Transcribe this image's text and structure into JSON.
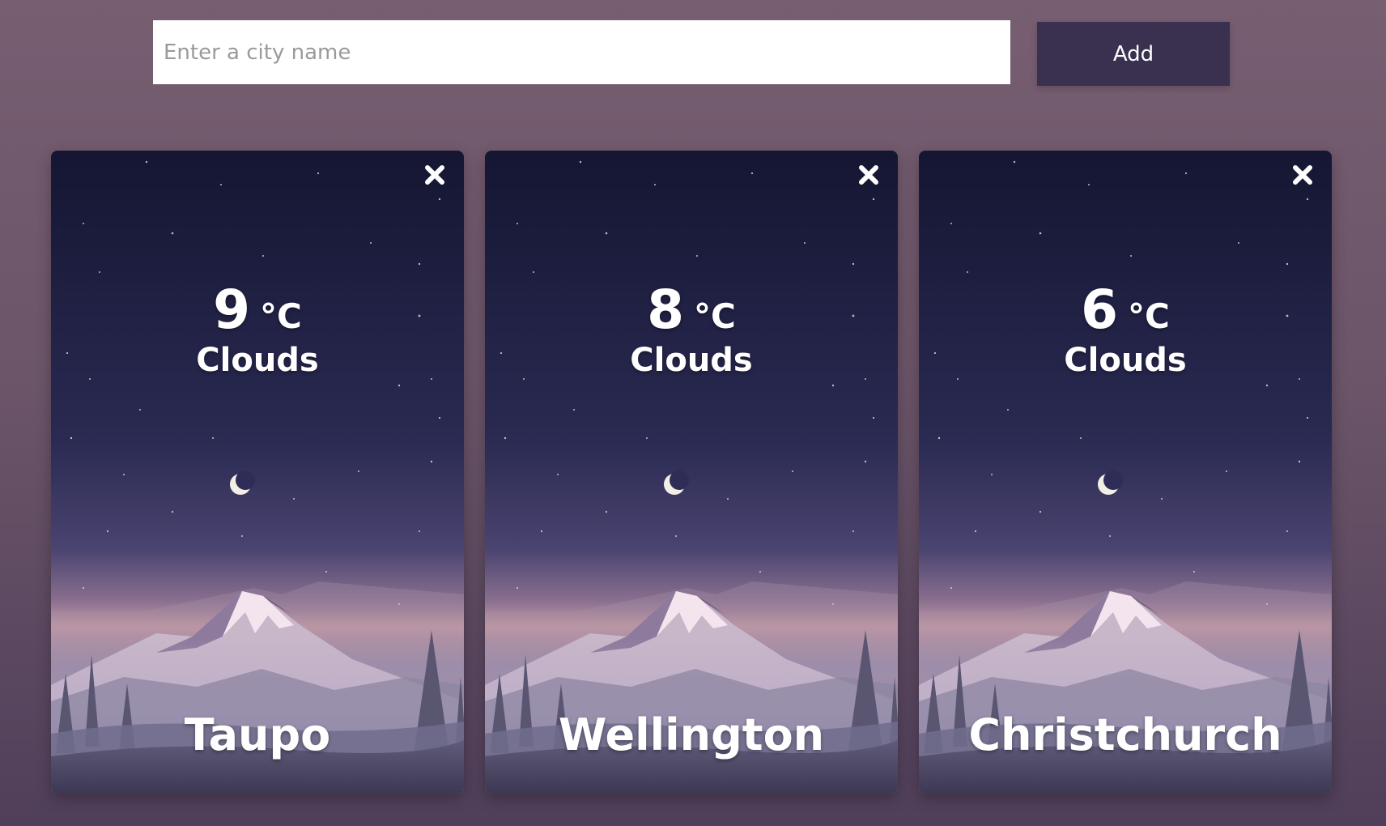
{
  "search": {
    "placeholder": "Enter a city name",
    "value": "",
    "add_label": "Add"
  },
  "cards": [
    {
      "temperature": "9",
      "unit": "°C",
      "condition": "Clouds",
      "city": "Taupo"
    },
    {
      "temperature": "8",
      "unit": "°C",
      "condition": "Clouds",
      "city": "Wellington"
    },
    {
      "temperature": "6",
      "unit": "°C",
      "condition": "Clouds",
      "city": "Christchurch"
    }
  ],
  "icons": {
    "close": "close-icon",
    "moon": "moon-icon"
  },
  "colors": {
    "background": "#6c5569",
    "button": "#3a3150",
    "sky_top": "#141632",
    "sky_mid": "#2e2c56",
    "horizon": "#c69aa4"
  }
}
